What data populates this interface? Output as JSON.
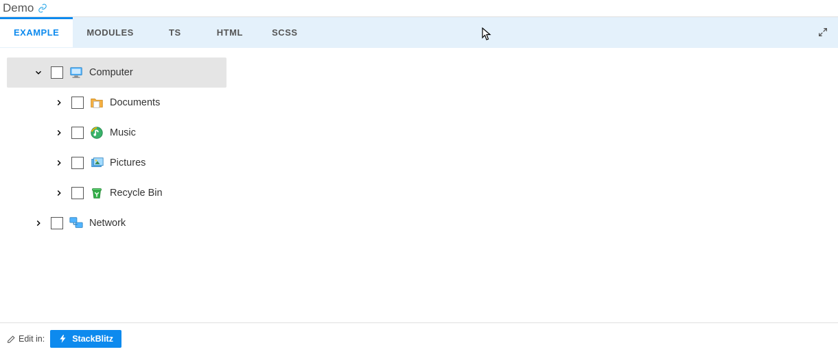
{
  "header": {
    "title": "Demo"
  },
  "tabs": [
    {
      "label": "EXAMPLE",
      "active": true
    },
    {
      "label": "MODULES",
      "active": false
    },
    {
      "label": "TS",
      "active": false
    },
    {
      "label": "HTML",
      "active": false
    },
    {
      "label": "SCSS",
      "active": false
    }
  ],
  "tree": {
    "nodes": [
      {
        "label": "Computer",
        "icon": "computer-icon",
        "level": 1,
        "expanded": true,
        "selected": true
      },
      {
        "label": "Documents",
        "icon": "folder-icon",
        "level": 2,
        "expanded": false,
        "selected": false
      },
      {
        "label": "Music",
        "icon": "music-icon",
        "level": 2,
        "expanded": false,
        "selected": false
      },
      {
        "label": "Pictures",
        "icon": "pictures-icon",
        "level": 2,
        "expanded": false,
        "selected": false
      },
      {
        "label": "Recycle Bin",
        "icon": "recyclebin-icon",
        "level": 2,
        "expanded": false,
        "selected": false
      },
      {
        "label": "Network",
        "icon": "network-icon",
        "level": 1,
        "expanded": false,
        "selected": false
      }
    ]
  },
  "footer": {
    "edit_in": "Edit in:",
    "stackblitz": "StackBlitz"
  }
}
